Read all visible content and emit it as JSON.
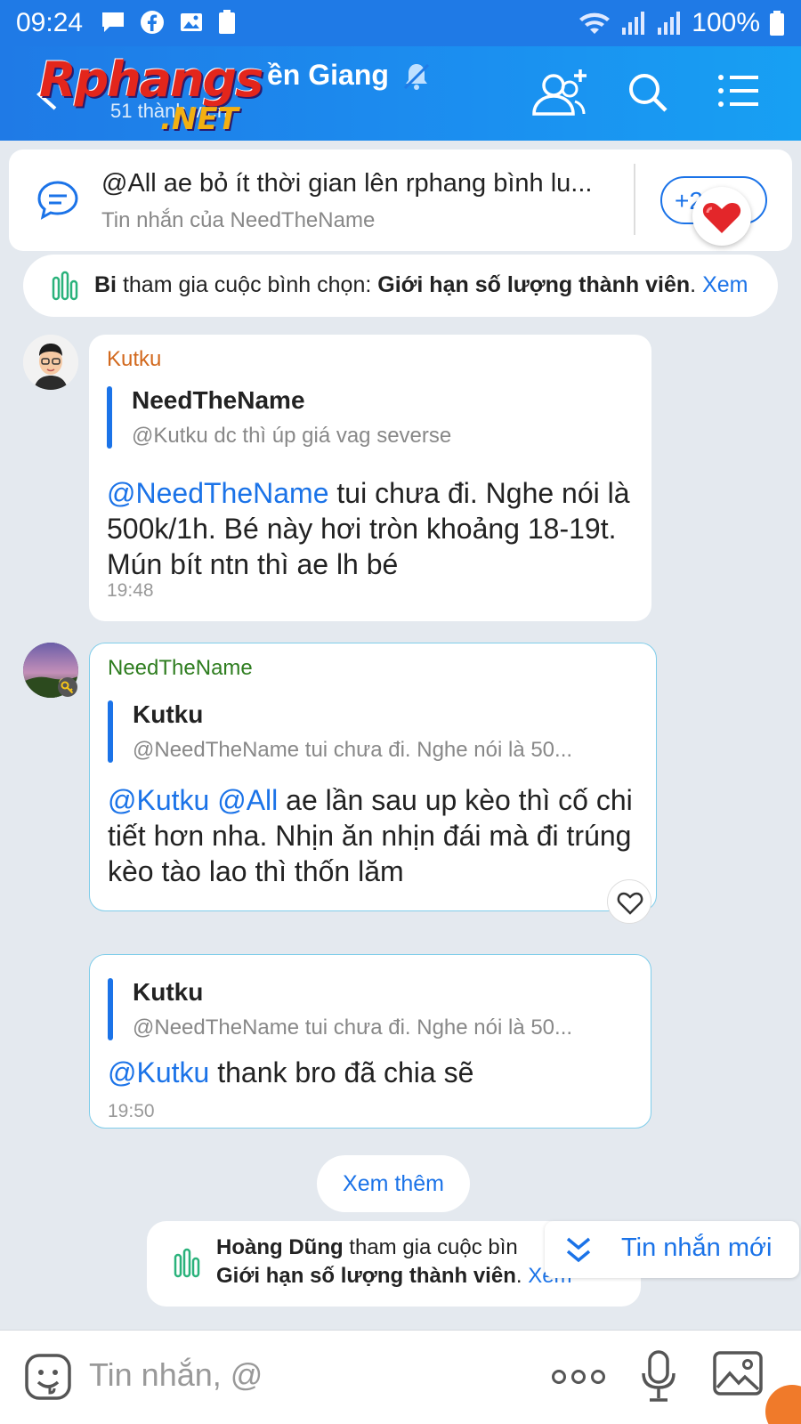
{
  "status_bar": {
    "time": "09:24",
    "battery": "100%"
  },
  "header": {
    "title": "ền Giang",
    "members": "51 thành viên",
    "watermark": {
      "main": "Rphangs",
      "sub": ".NET"
    }
  },
  "pinned": {
    "text": "@All ae bỏ ít thời gian lên rphang bình lu...",
    "subtitle": "Tin nhắn của NeedTheName",
    "more": "+2"
  },
  "poll_notice": {
    "user": "Bi",
    "action": " tham gia cuộc bình chọn: ",
    "poll": "Giới hạn số lượng thành viên",
    "dot": ".",
    "link": "Xem"
  },
  "messages": [
    {
      "sender": "Kutku",
      "sender_color": "#d2691e",
      "quote_name": "NeedTheName",
      "quote_text": "@Kutku dc thì úp giá vag severse",
      "mention": "@NeedTheName",
      "body": " tui chưa đi.  Nghe nói là 500k/1h. Bé này hơi tròn khoảng 18-19t. Mún bít ntn thì ae lh bé",
      "time": "19:48"
    },
    {
      "sender": "NeedTheName",
      "sender_color": "#2e7d1f",
      "quote_name": "Kutku",
      "quote_text": "@NeedTheName tui chưa đi.  Nghe nói là 50...",
      "mention": "@Kutku @All",
      "body": " ae lần sau up kèo thì cố chi tiết hơn nha. Nhịn ăn nhịn đái mà đi trúng kèo tào lao thì thốn lăm"
    },
    {
      "quote_name": "Kutku",
      "quote_text": "@NeedTheName tui chưa đi.  Nghe nói là 50...",
      "mention": "@Kutku",
      "body": " thank bro đã chia sẽ",
      "time": "19:50"
    }
  ],
  "see_more": "Xem thêm",
  "poll_notice2": {
    "user": "Hoàng Dũng",
    "action": " tham gia cuộc bìn",
    "poll": "Giới hạn số lượng thành viên",
    "dot": ". ",
    "link": "Xem"
  },
  "new_messages": "Tin nhắn mới",
  "composer": {
    "placeholder": "Tin nhắn, @"
  },
  "colors": {
    "accent": "#1b73e8",
    "header": "#1f7ae6",
    "background": "#e4e9ef"
  }
}
